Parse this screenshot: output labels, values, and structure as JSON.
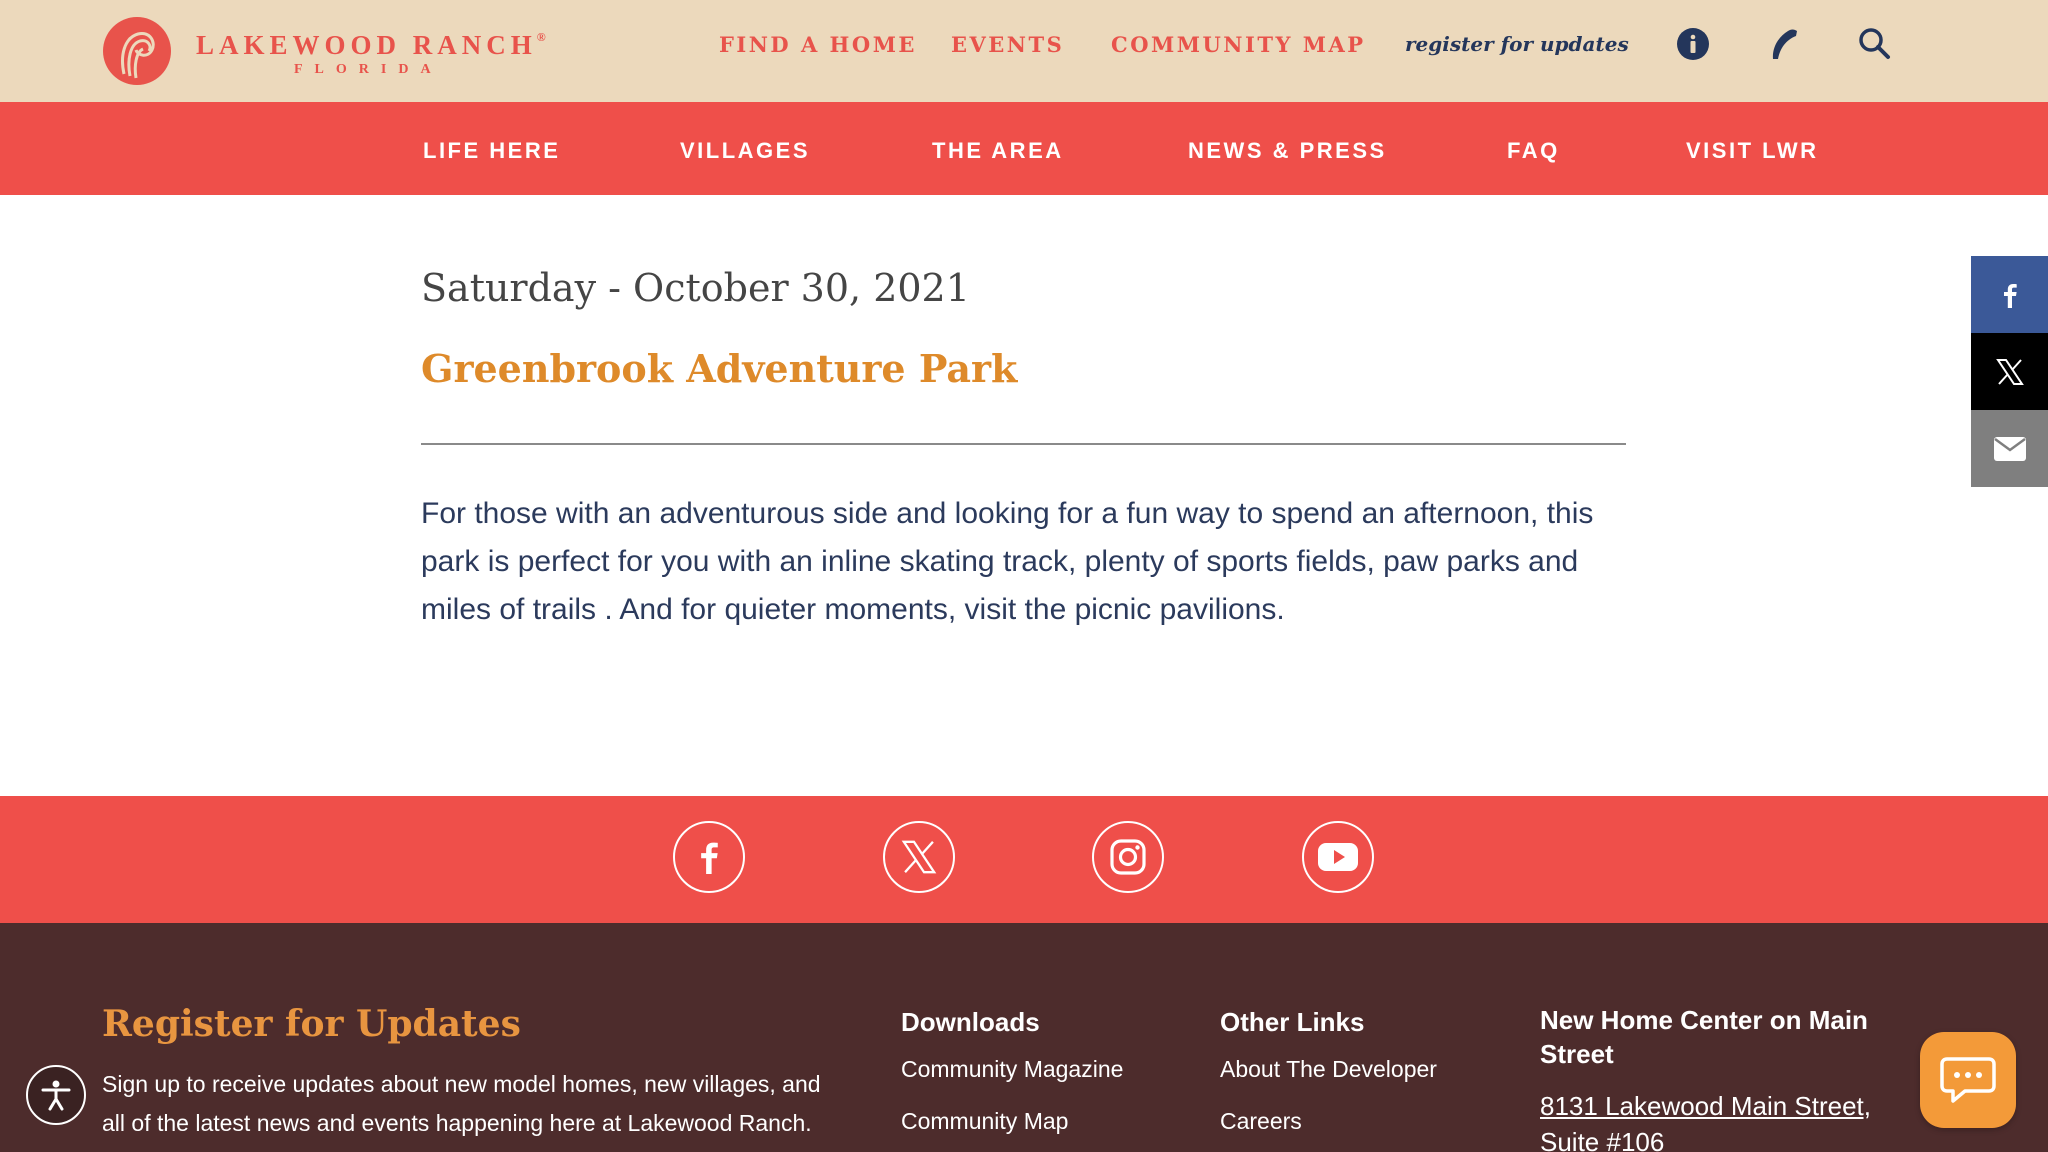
{
  "brand": {
    "name": "LAKEWOOD RANCH",
    "name_suffix": "®",
    "location": "FLORIDA",
    "color": "#e8534b"
  },
  "header": {
    "nav": [
      "FIND A HOME",
      "EVENTS",
      "COMMUNITY MAP"
    ],
    "register_link": "register for updates",
    "icons": [
      "info-icon",
      "phone-icon",
      "search-icon"
    ]
  },
  "main_nav": {
    "items": [
      "LIFE HERE",
      "VILLAGES",
      "THE AREA",
      "NEWS & PRESS",
      "FAQ",
      "VISIT LWR"
    ],
    "color": "#ef4f4a"
  },
  "event": {
    "date": "Saturday - October 30, 2021",
    "title": "Greenbrook Adventure Park",
    "description": "For those with an adventurous side and looking for a fun way to spend an afternoon, this park is perfect for you with an inline skating track, plenty of sports fields, paw parks and miles of trails . And for quieter moments, visit the picnic pavilions."
  },
  "share_sidebar": [
    "facebook-icon",
    "x-icon",
    "email-icon"
  ],
  "social_links": [
    "facebook-icon",
    "x-icon",
    "instagram-icon",
    "youtube-icon"
  ],
  "footer": {
    "register": {
      "heading": "Register for Updates",
      "text": "Sign up to receive updates about new model homes, new villages, and all of the latest news and events happening here at Lakewood Ranch."
    },
    "downloads": {
      "heading": "Downloads",
      "links": [
        "Community Magazine",
        "Community Map"
      ]
    },
    "other_links": {
      "heading": "Other Links",
      "links": [
        "About The Developer",
        "Careers"
      ]
    },
    "new_home_center": {
      "heading": "New Home Center on Main Street",
      "address": "8131 Lakewood Main Street, Suite #106"
    }
  }
}
